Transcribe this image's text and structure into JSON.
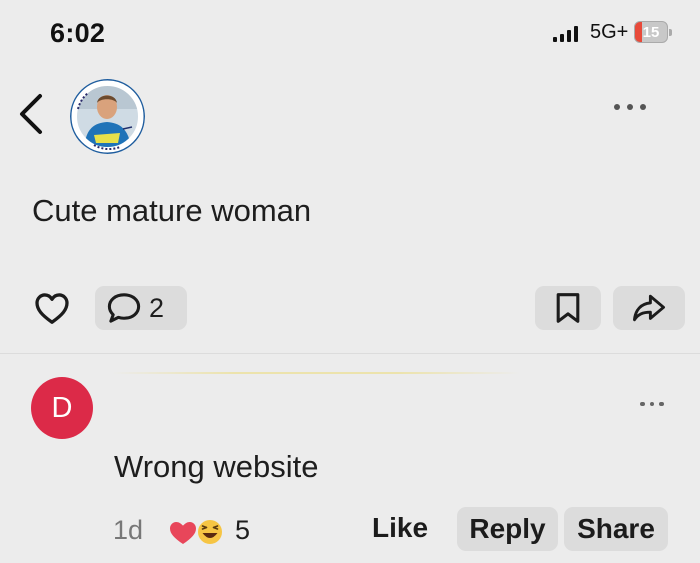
{
  "status_bar": {
    "time": "6:02",
    "network": "5G+",
    "battery": "15"
  },
  "header": {
    "back_icon": "chevron-left-icon",
    "more_icon": "more-horizontal-icon"
  },
  "post": {
    "text": "Cute mature woman",
    "comment_count": "2",
    "icons": {
      "like": "heart-outline-icon",
      "comment": "speech-bubble-icon",
      "save": "bookmark-icon",
      "share": "share-arrow-icon"
    }
  },
  "comment": {
    "author_initial": "D",
    "avatar_color": "#dc2a48",
    "text": "Wrong website",
    "time": "1d",
    "reaction_count": "5",
    "reaction_icons": [
      "heart-reaction-icon",
      "laughing-reaction-icon"
    ],
    "like_label": "Like",
    "reply_label": "Reply",
    "share_label": "Share"
  },
  "colors": {
    "background": "#ececec",
    "pill_background": "#dcdcdc",
    "battery_low": "#e84a3a"
  }
}
